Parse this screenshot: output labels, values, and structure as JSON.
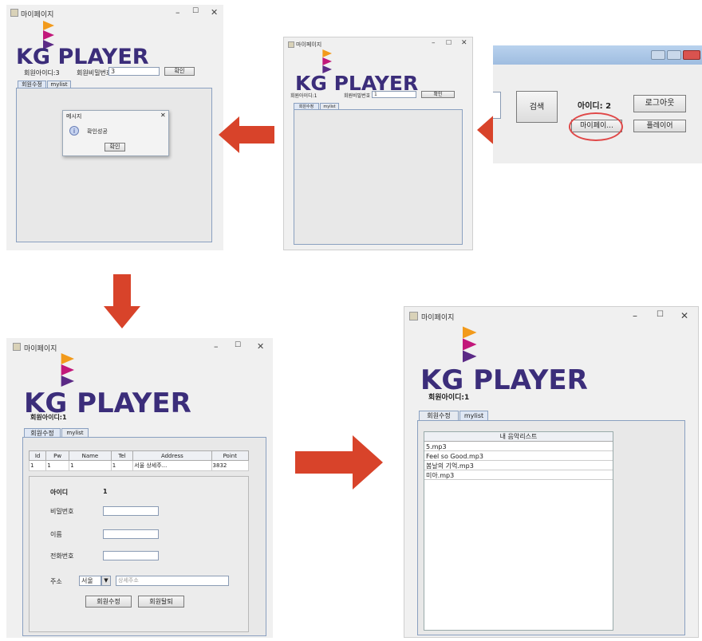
{
  "colors": {
    "arrow": "#d8432a",
    "logo_text": "#3b2d7a",
    "logo_orange": "#f29a1b",
    "logo_magenta": "#c2187a",
    "logo_purple": "#5b2a86",
    "highlight_circle": "#e04848"
  },
  "icons": [
    "app-icon",
    "minimize-icon",
    "maximize-icon",
    "close-icon",
    "info-icon",
    "dropdown-arrow-icon",
    "red-arrow-right",
    "red-arrow-left",
    "red-arrow-down"
  ],
  "win1": {
    "title": "마이페이지",
    "logo": "KG PLAYER",
    "id_label": "회원아이디:3",
    "pw_label": "회원비밀번호",
    "pw_value": "3",
    "confirm_btn": "확인",
    "tabs": [
      "회원수정",
      "mylist"
    ],
    "dialog": {
      "title": "메시지",
      "message": "확인성공",
      "ok": "확인",
      "close": "✕"
    }
  },
  "win2": {
    "title": "마이페이지",
    "logo": "KG PLAYER",
    "id_label": "회원아이디:1",
    "pw_label": "회원비밀번호",
    "pw_value": "1",
    "confirm_btn": "확인",
    "tabs": [
      "회원수정",
      "mylist"
    ]
  },
  "win3": {
    "search_btn": "검색",
    "id_label": "아이디: 2",
    "logout_btn": "로그아웃",
    "mypage_btn": "마이페이...",
    "player_btn": "플레이어"
  },
  "win4": {
    "title": "마이페이지",
    "logo": "KG PLAYER",
    "id_label": "회원아이디:1",
    "tabs": [
      "회원수정",
      "mylist"
    ],
    "table": {
      "headers": [
        "Id",
        "Pw",
        "Name",
        "Tel",
        "Address",
        "Point"
      ],
      "rows": [
        [
          "1",
          "1",
          "1",
          "1",
          "서울 상세주...",
          "3832"
        ]
      ]
    },
    "form": {
      "id_label": "아이디",
      "id_value": "1",
      "pw_label": "비밀번호",
      "name_label": "이름",
      "tel_label": "전화번호",
      "addr_label": "주소",
      "city_value": "서울",
      "detail_placeholder": "상세주소",
      "update_btn": "회원수정",
      "delete_btn": "회원탈퇴"
    }
  },
  "win5": {
    "title": "마이페이지",
    "logo": "KG PLAYER",
    "id_label": "회원아이디:1",
    "tabs": [
      "회원수정",
      "mylist"
    ],
    "list_header": "내 음악리스트",
    "songs": [
      "5.mp3",
      "Feel so Good.mp3",
      "봄날의 기억.mp3",
      "미아.mp3"
    ]
  },
  "winctl": {
    "min": "–",
    "max": "☐",
    "close": "✕"
  }
}
